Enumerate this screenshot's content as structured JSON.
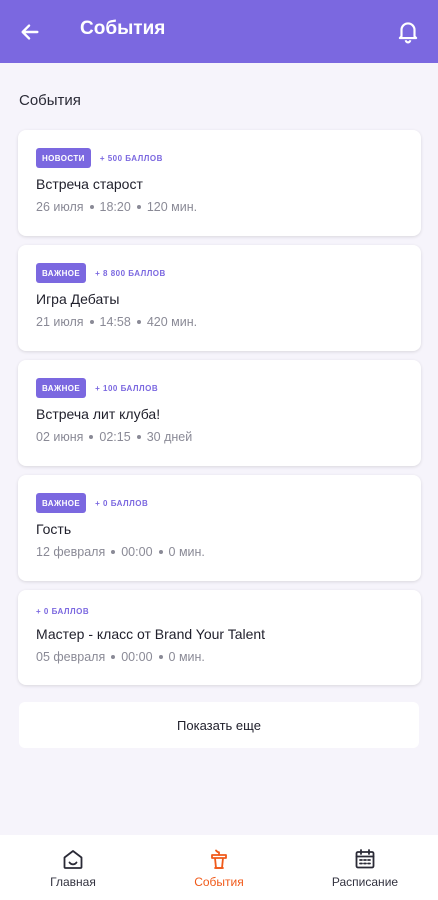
{
  "header": {
    "title": "События",
    "back_icon": "arrow-left-icon",
    "notifications_icon": "bell-icon"
  },
  "section_title": "События",
  "events": [
    {
      "badge": "НОВОСТИ",
      "points": "+ 500 БАЛЛОВ",
      "title": "Встреча старост",
      "date": "26 июля",
      "time": "18:20",
      "duration": "120 мин."
    },
    {
      "badge": "ВАЖНОЕ",
      "points": "+ 8 800 БАЛЛОВ",
      "title": "Игра Дебаты",
      "date": "21 июля",
      "time": "14:58",
      "duration": "420 мин."
    },
    {
      "badge": "ВАЖНОЕ",
      "points": "+ 100 БАЛЛОВ",
      "title": "Встреча лит клуба!",
      "date": "02 июня",
      "time": "02:15",
      "duration": "30 дней"
    },
    {
      "badge": "ВАЖНОЕ",
      "points": "+ 0 БАЛЛОВ",
      "title": "Гость",
      "date": "12 февраля",
      "time": "00:00",
      "duration": "0 мин."
    },
    {
      "badge": "",
      "points": "+ 0 БАЛЛОВ",
      "title": "Мастер - класс от Brand Your Talent",
      "date": "05 февраля",
      "time": "00:00",
      "duration": "0 мин."
    }
  ],
  "show_more_label": "Показать еще",
  "nav": {
    "home": {
      "label": "Главная",
      "icon": "home-icon"
    },
    "events": {
      "label": "События",
      "icon": "podium-icon"
    },
    "schedule": {
      "label": "Расписание",
      "icon": "calendar-icon"
    }
  },
  "colors": {
    "accent": "#7b68e0",
    "active_nav": "#f05a1a",
    "background": "#f6f4fb"
  }
}
